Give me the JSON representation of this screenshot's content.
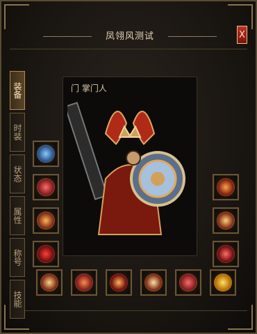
{
  "window": {
    "title": "凤翎风测试",
    "close_label": "X"
  },
  "tabs": [
    {
      "label": "装备",
      "active": true
    },
    {
      "label": "时装",
      "active": false
    },
    {
      "label": "状态",
      "active": false
    },
    {
      "label": "属性",
      "active": false
    },
    {
      "label": "称号",
      "active": false
    },
    {
      "label": "技能",
      "active": false
    }
  ],
  "character": {
    "name": "门 掌门人"
  },
  "equipment_slots": {
    "left": [
      {
        "name": "amulet-slot"
      },
      {
        "name": "ring-slot"
      },
      {
        "name": "bracelet-slot"
      },
      {
        "name": "boots-slot"
      }
    ],
    "right": [
      {
        "name": "necklace-slot"
      },
      {
        "name": "bracelet-slot"
      },
      {
        "name": "ring-slot"
      }
    ],
    "bottom": [
      {
        "name": "helmet-slot"
      },
      {
        "name": "belt-slot"
      },
      {
        "name": "gloves-slot"
      },
      {
        "name": "charm-slot"
      },
      {
        "name": "medal-slot"
      },
      {
        "name": "talisman-slot"
      }
    ]
  },
  "colors": {
    "frame": "#5a4a33",
    "accent_gold": "#d1a15a",
    "active_tab": "#5a4426",
    "close_red": "#c03024"
  }
}
